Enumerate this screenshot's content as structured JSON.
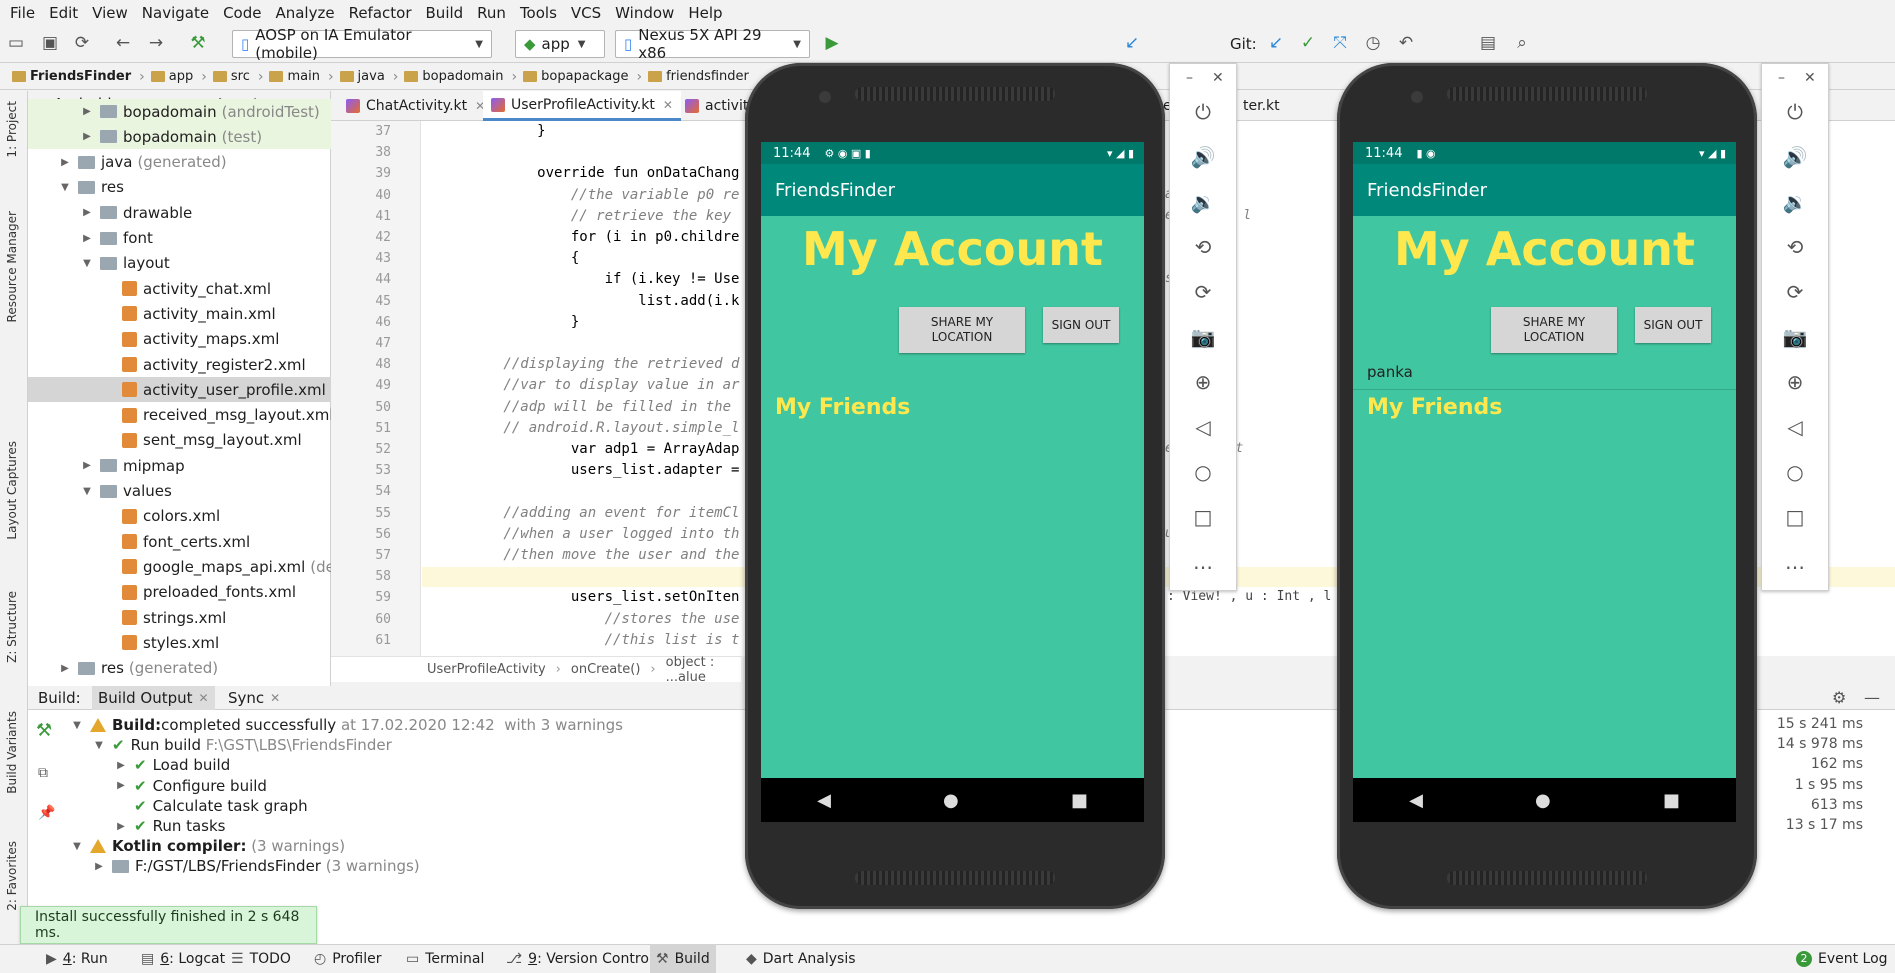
{
  "menu": [
    "File",
    "Edit",
    "View",
    "Navigate",
    "Code",
    "Analyze",
    "Refactor",
    "Build",
    "Run",
    "Tools",
    "VCS",
    "Window",
    "Help"
  ],
  "toolbar": {
    "device_config": "AOSP on IA Emulator (mobile)",
    "run_config": "app",
    "avd": "Nexus 5X API 29 x86",
    "git_label": "Git:"
  },
  "breadcrumb": [
    "FriendsFinder",
    "app",
    "src",
    "main",
    "java",
    "bopadomain",
    "bopapackage",
    "friendsfinder"
  ],
  "left_tools": [
    "1: Project",
    "Resource Manager",
    "Layout Captures",
    "Z: Structure",
    "Build Variants",
    "2: Favorites"
  ],
  "project": {
    "view": "Android",
    "tree": [
      {
        "label": "bopadomain",
        "suffix": "(androidTest)",
        "indent": 2,
        "type": "folder",
        "arrow": "▶"
      },
      {
        "label": "bopadomain",
        "suffix": "(test)",
        "indent": 2,
        "type": "folder",
        "arrow": "▶"
      },
      {
        "label": "java",
        "suffix": "(generated)",
        "indent": 1,
        "type": "folder",
        "arrow": "▶"
      },
      {
        "label": "res",
        "suffix": "",
        "indent": 1,
        "type": "folder",
        "arrow": "▼"
      },
      {
        "label": "drawable",
        "suffix": "",
        "indent": 2,
        "type": "folder",
        "arrow": "▶"
      },
      {
        "label": "font",
        "suffix": "",
        "indent": 2,
        "type": "folder",
        "arrow": "▶"
      },
      {
        "label": "layout",
        "suffix": "",
        "indent": 2,
        "type": "folder",
        "arrow": "▼"
      },
      {
        "label": "activity_chat.xml",
        "suffix": "",
        "indent": 3,
        "type": "xml",
        "arrow": ""
      },
      {
        "label": "activity_main.xml",
        "suffix": "",
        "indent": 3,
        "type": "xml",
        "arrow": ""
      },
      {
        "label": "activity_maps.xml",
        "suffix": "",
        "indent": 3,
        "type": "xml",
        "arrow": ""
      },
      {
        "label": "activity_register2.xml",
        "suffix": "",
        "indent": 3,
        "type": "xml",
        "arrow": ""
      },
      {
        "label": "activity_user_profile.xml",
        "suffix": "",
        "indent": 3,
        "type": "xml",
        "arrow": "",
        "selected": true
      },
      {
        "label": "received_msg_layout.xml",
        "suffix": "",
        "indent": 3,
        "type": "xml",
        "arrow": ""
      },
      {
        "label": "sent_msg_layout.xml",
        "suffix": "",
        "indent": 3,
        "type": "xml",
        "arrow": ""
      },
      {
        "label": "mipmap",
        "suffix": "",
        "indent": 2,
        "type": "folder",
        "arrow": "▶"
      },
      {
        "label": "values",
        "suffix": "",
        "indent": 2,
        "type": "folder",
        "arrow": "▼"
      },
      {
        "label": "colors.xml",
        "suffix": "",
        "indent": 3,
        "type": "xml",
        "arrow": ""
      },
      {
        "label": "font_certs.xml",
        "suffix": "",
        "indent": 3,
        "type": "xml",
        "arrow": ""
      },
      {
        "label": "google_maps_api.xml",
        "suffix": "(debu",
        "indent": 3,
        "type": "xml",
        "arrow": ""
      },
      {
        "label": "preloaded_fonts.xml",
        "suffix": "",
        "indent": 3,
        "type": "xml",
        "arrow": ""
      },
      {
        "label": "strings.xml",
        "suffix": "",
        "indent": 3,
        "type": "xml",
        "arrow": ""
      },
      {
        "label": "styles.xml",
        "suffix": "",
        "indent": 3,
        "type": "xml",
        "arrow": ""
      },
      {
        "label": "res",
        "suffix": "(generated)",
        "indent": 1,
        "type": "folder",
        "arrow": "▶"
      }
    ]
  },
  "editor": {
    "tabs": [
      {
        "label": "ChatActivity.kt",
        "active": false
      },
      {
        "label": "UserProfileActivity.kt",
        "active": true
      },
      {
        "label": "activity",
        "active": false
      }
    ],
    "tabs_right": [
      "es",
      "ter.kt",
      "C"
    ],
    "lines": [
      {
        "n": "37",
        "code": "            }"
      },
      {
        "n": "38",
        "code": ""
      },
      {
        "n": "39",
        "code": "            override fun onDataChang"
      },
      {
        "n": "40",
        "code": "                //the variable p0 re"
      },
      {
        "n": "41",
        "code": "                // retrieve the key"
      },
      {
        "n": "42",
        "code": "                for (i in p0.childre"
      },
      {
        "n": "43",
        "code": "                {"
      },
      {
        "n": "44",
        "code": "                    if (i.key != Use"
      },
      {
        "n": "45",
        "code": "                        list.add(i.k"
      },
      {
        "n": "46",
        "code": "                }"
      },
      {
        "n": "47",
        "code": ""
      },
      {
        "n": "48",
        "code": "        //displaying the retrieved d"
      },
      {
        "n": "49",
        "code": "        //var to display value in ar"
      },
      {
        "n": "50",
        "code": "        //adp will be filled in the"
      },
      {
        "n": "51",
        "code": "        // android.R.layout.simple_l"
      },
      {
        "n": "52",
        "code": "                var adp1 = ArrayAdap"
      },
      {
        "n": "53",
        "code": "                users_list.adapter ="
      },
      {
        "n": "54",
        "code": ""
      },
      {
        "n": "55",
        "code": "        //adding an event for itemCl"
      },
      {
        "n": "56",
        "code": "        //when a user logged into th"
      },
      {
        "n": "57",
        "code": "        //then move the user and the"
      },
      {
        "n": "58",
        "code": ""
      },
      {
        "n": "59",
        "code": "                users_list.setOnIten"
      },
      {
        "n": "60",
        "code": "                    //stores the use"
      },
      {
        "n": "61",
        "code": "                    //this list is t"
      }
    ],
    "right_fragments": {
      "l40": "a",
      "l41": "em to the l",
      "l44": "s",
      "l52": "em_1, list",
      "l56": "u",
      "l59": ": View! , u : Int , l : L"
    },
    "breadcrumb": [
      "UserProfileActivity",
      "onCreate()",
      "object : ...alue"
    ]
  },
  "build": {
    "tabs": [
      "Build:",
      "Build Output",
      "Sync"
    ],
    "rows": [
      {
        "indent": 0,
        "arrow": "▼",
        "icon": "warn",
        "bold": "Build:",
        "text": " completed successfully",
        "grey": " at 17.02.2020 12:42  with 3 warnings",
        "time": "15 s 241 ms"
      },
      {
        "indent": 1,
        "arrow": "▼",
        "icon": "ok",
        "bold": "",
        "text": "Run build",
        "grey": " F:\\GST\\LBS\\FriendsFinder",
        "time": "14 s 978 ms"
      },
      {
        "indent": 2,
        "arrow": "▶",
        "icon": "ok",
        "bold": "",
        "text": "Load build",
        "grey": "",
        "time": "162 ms"
      },
      {
        "indent": 2,
        "arrow": "▶",
        "icon": "ok",
        "bold": "",
        "text": "Configure build",
        "grey": "",
        "time": "1 s 95 ms"
      },
      {
        "indent": 2,
        "arrow": "",
        "icon": "ok",
        "bold": "",
        "text": "Calculate task graph",
        "grey": "",
        "time": "613 ms"
      },
      {
        "indent": 2,
        "arrow": "▶",
        "icon": "ok",
        "bold": "",
        "text": "Run tasks",
        "grey": "",
        "time": "13 s 17 ms"
      },
      {
        "indent": 0,
        "arrow": "▼",
        "icon": "warn",
        "bold": "Kotlin compiler:",
        "text": "",
        "grey": " (3 warnings)",
        "time": ""
      },
      {
        "indent": 1,
        "arrow": "▶",
        "icon": "folder",
        "bold": "",
        "text": "F:/GST/LBS/FriendsFinder",
        "grey": " (3 warnings)",
        "time": ""
      }
    ]
  },
  "toast": "Install successfully finished in 2 s 648 ms.",
  "bottom_tools": [
    {
      "key": "4",
      "label": ": Run"
    },
    {
      "key": "6",
      "label": ": Logcat"
    },
    {
      "key": "",
      "label": "TODO"
    },
    {
      "key": "",
      "label": "Profiler"
    },
    {
      "key": "",
      "label": "Terminal"
    },
    {
      "key": "9",
      "label": ": Version Control"
    },
    {
      "key": "",
      "label": "Build"
    },
    {
      "key": "",
      "label": "Dart Analysis"
    }
  ],
  "event_log": {
    "count": "2",
    "label": "Event Log"
  },
  "phones": [
    {
      "time": "11:44",
      "app_title": "FriendsFinder",
      "heading": "My Account",
      "share_label": "SHARE MY\nLOCATION",
      "signout_label": "SIGN OUT",
      "list_item": "",
      "friends_label": "My Friends"
    },
    {
      "time": "11:44",
      "app_title": "FriendsFinder",
      "heading": "My Account",
      "share_label": "SHARE MY\nLOCATION",
      "signout_label": "SIGN OUT",
      "list_item": "panka",
      "friends_label": "My Friends"
    }
  ],
  "colors": {
    "accent": "#40c6a0",
    "status": "#00796b",
    "appbar": "#00897b",
    "heading": "#ffe84d"
  }
}
